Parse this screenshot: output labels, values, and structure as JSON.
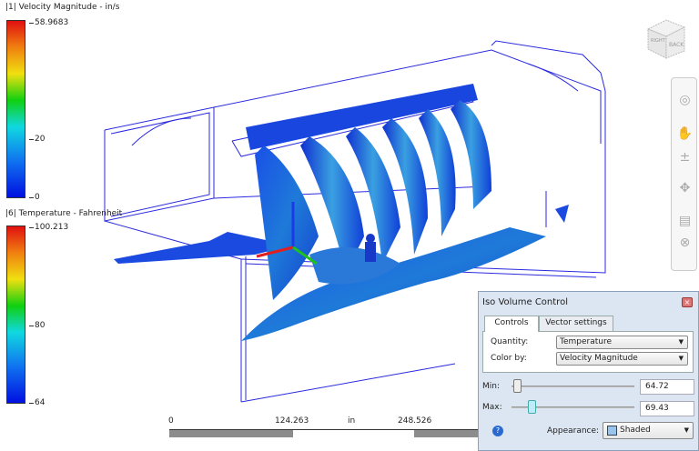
{
  "legends": [
    {
      "title": "|1| Velocity Magnitude - in/s",
      "max": "58.9683",
      "mid": "20",
      "min": "0"
    },
    {
      "title": "|6| Temperature - Fahrenheit",
      "max": "100.213",
      "mid": "80",
      "min": "64"
    }
  ],
  "scale_bar": {
    "start": "0",
    "mid": "124.263",
    "unit": "in",
    "end": "248.526"
  },
  "view_cube": {
    "faces": [
      "BACK",
      "RIGHT"
    ]
  },
  "nav_bar": {
    "tools": [
      "steering-wheel-icon",
      "pan-icon",
      "zoom-icon",
      "orbit-icon",
      "look-at-icon",
      "center-icon"
    ]
  },
  "dialog": {
    "title": "Iso Volume Control",
    "tabs": [
      "Controls",
      "Vector settings"
    ],
    "quantity_label": "Quantity:",
    "quantity_value": "Temperature",
    "color_by_label": "Color by:",
    "color_by_value": "Velocity Magnitude",
    "min_label": "Min:",
    "min_value": "64.72",
    "max_label": "Max:",
    "max_value": "69.43",
    "min_slider_fraction": 0.02,
    "max_slider_fraction": 0.14,
    "appearance_label": "Appearance:",
    "appearance_value": "Shaded"
  }
}
